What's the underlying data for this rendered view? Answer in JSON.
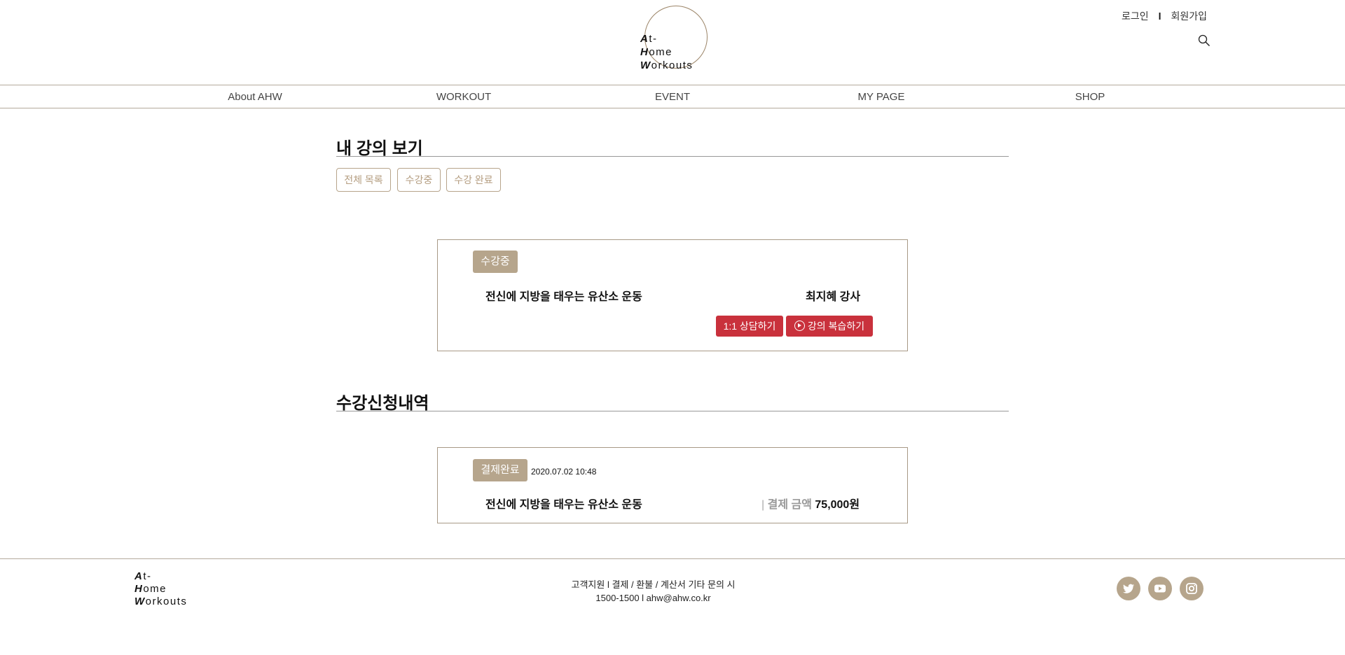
{
  "header": {
    "logo_line1": "t-",
    "logo_line2": "ome",
    "logo_line3": "orkouts",
    "logo_cap1": "A",
    "logo_cap2": "H",
    "logo_cap3": "W",
    "login": "로그인",
    "separator": "l",
    "signup": "회원가입"
  },
  "nav": [
    "About AHW",
    "WORKOUT",
    "EVENT",
    "MY PAGE",
    "SHOP"
  ],
  "my_courses": {
    "title": "내 강의 보기",
    "filters": [
      "전체 목록",
      "수강중",
      "수강 완료"
    ],
    "card": {
      "status": "수강중",
      "course_name": "전신에 지방을 태우는 유산소 운동",
      "instructor": "최지혜 강사",
      "consult_button": "1:1 상담하기",
      "review_button": "강의 복습하기"
    }
  },
  "history": {
    "title": "수강신청내역",
    "card": {
      "status": "결제완료",
      "datetime": "2020.07.02 10:48",
      "course_name": "전신에 지방을 태우는 유산소 운동",
      "amount_sep": "|",
      "amount_label": "결제 금액",
      "amount": "75,000원"
    }
  },
  "footer": {
    "logo_cap1": "A",
    "logo_cap2": "H",
    "logo_cap3": "W",
    "logo_line1": "t-",
    "logo_line2": "ome",
    "logo_line3": "orkouts",
    "support": "고객지원 l 결제 / 환불 / 계산서 기타 문의 시",
    "contact": "1500-1500 l ahw@ahw.co.kr",
    "social_icons": [
      "twitter-icon",
      "youtube-icon",
      "instagram-icon"
    ]
  },
  "colors": {
    "accent": "#b6a58c",
    "red": "#c9313c",
    "line": "#b4aa9c"
  }
}
